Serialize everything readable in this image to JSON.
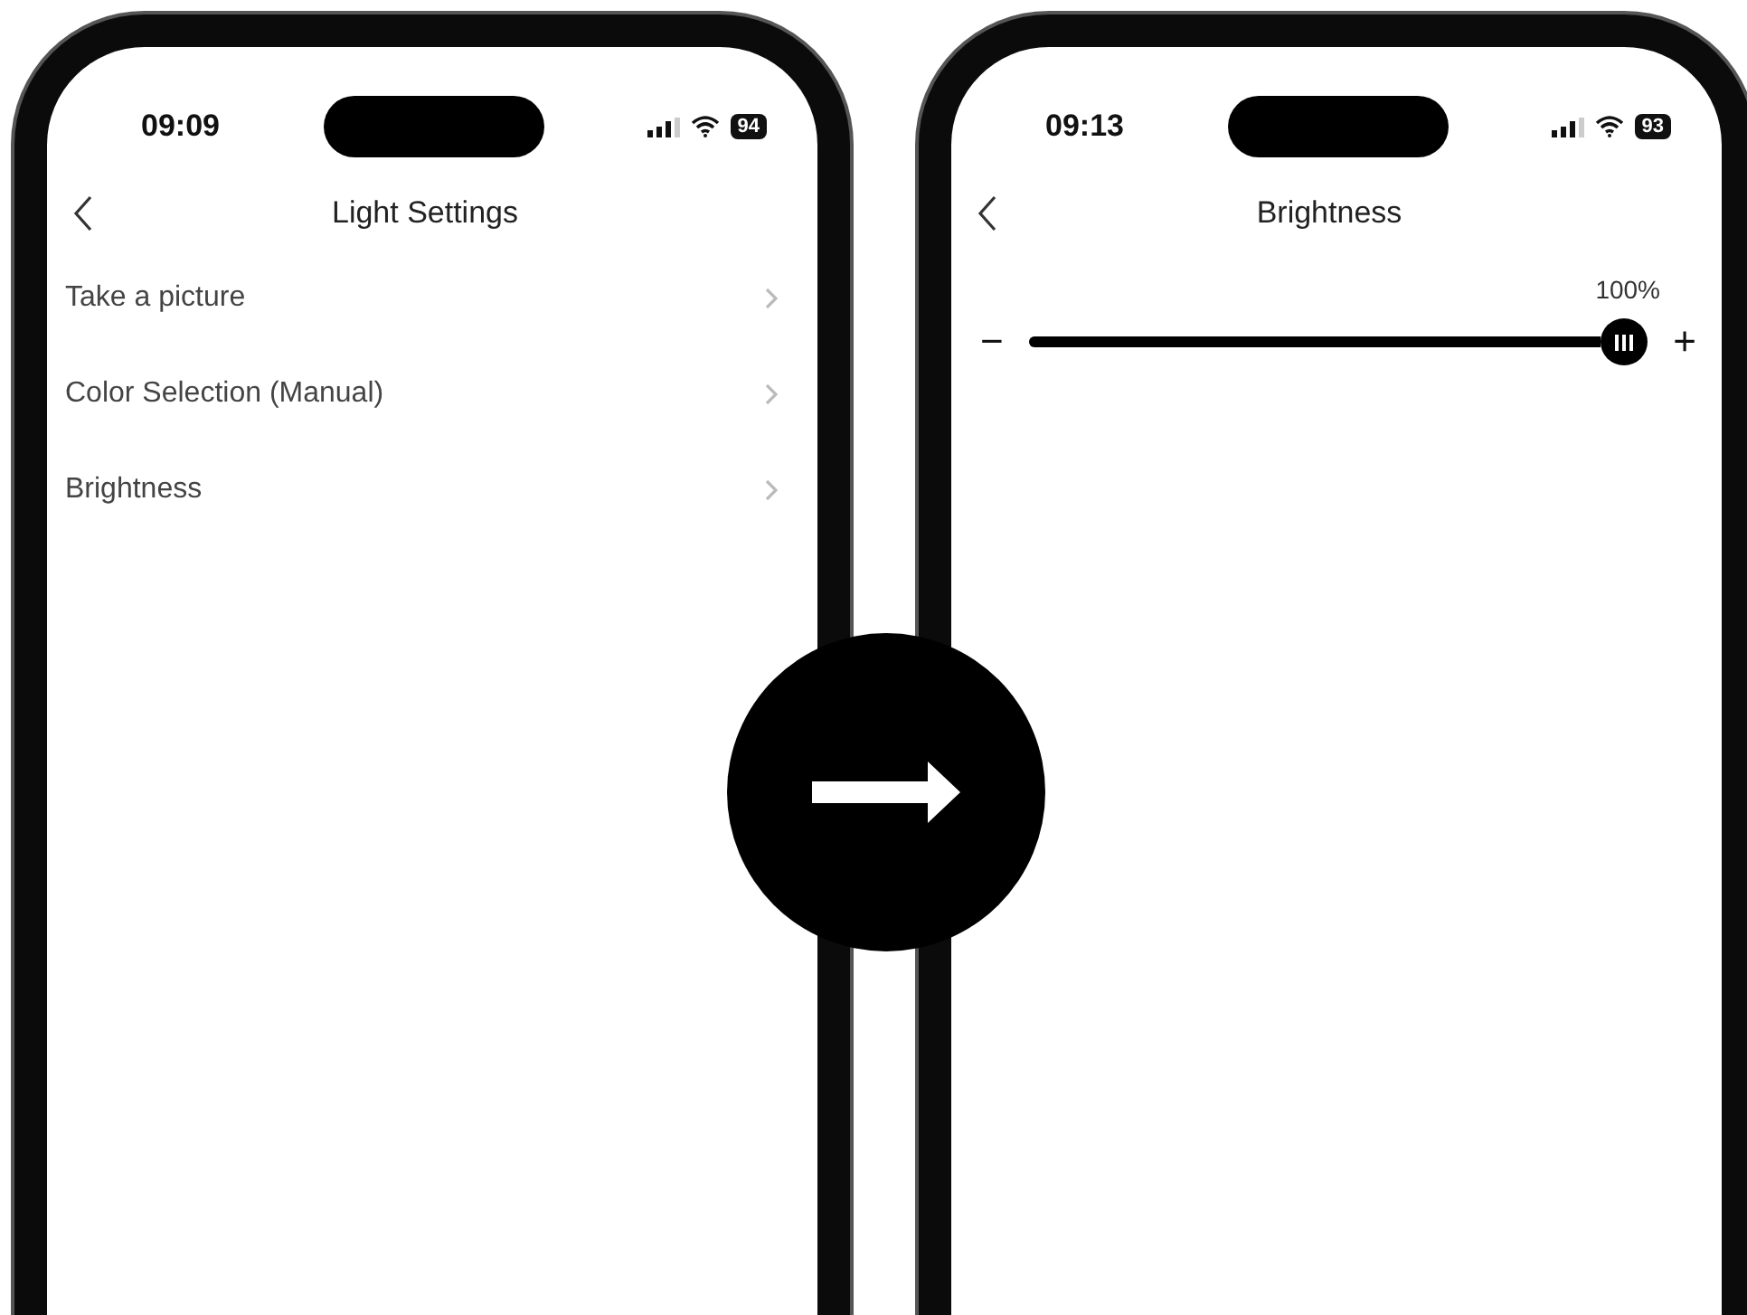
{
  "phones": [
    {
      "status": {
        "time": "09:09",
        "battery": "94"
      },
      "screen": {
        "kind": "menu",
        "title": "Light Settings",
        "items": [
          {
            "label": "Take a picture"
          },
          {
            "label": "Color Selection (Manual)"
          },
          {
            "label": "Brightness"
          }
        ]
      }
    },
    {
      "status": {
        "time": "09:13",
        "battery": "93"
      },
      "screen": {
        "kind": "slider",
        "title": "Brightness",
        "reading": "100%",
        "level": 1,
        "minus": "−",
        "plus": "+"
      }
    }
  ]
}
